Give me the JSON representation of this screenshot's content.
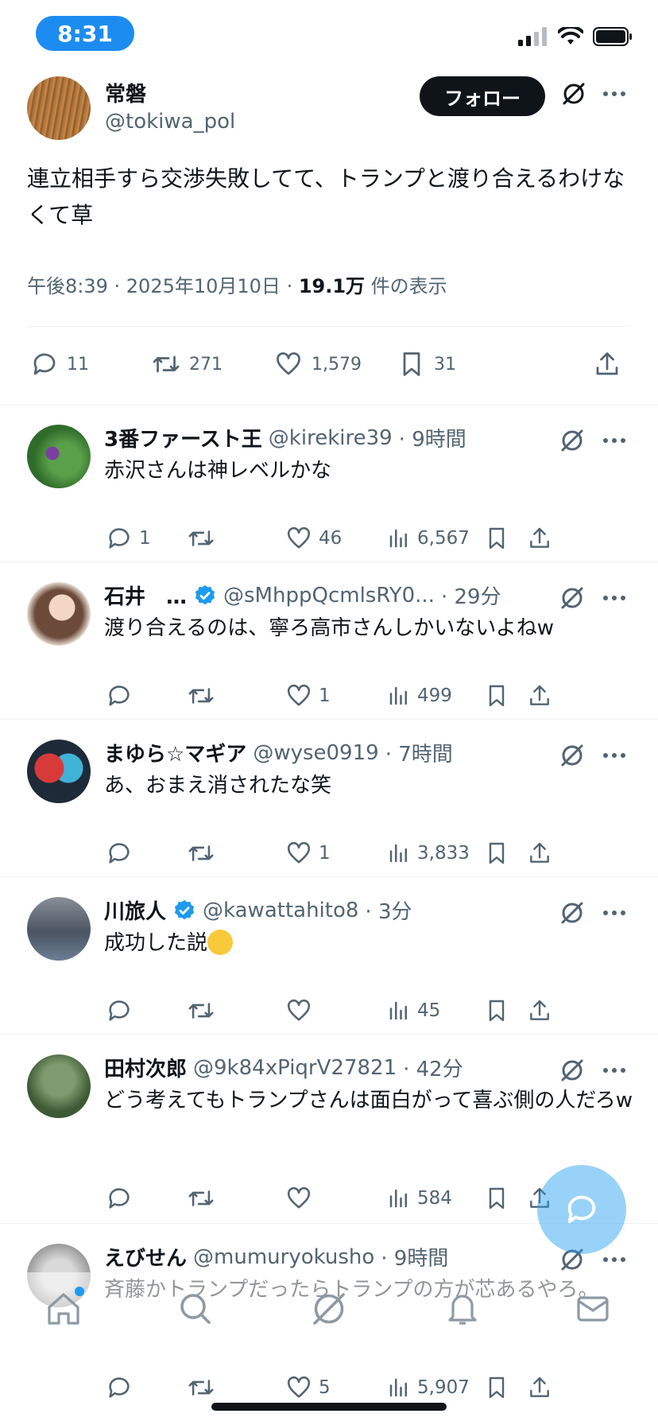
{
  "status_bar": {
    "time": "8:31"
  },
  "main_tweet": {
    "name": "常磐",
    "handle": "@tokiwa_pol",
    "follow_label": "フォロー",
    "text": "連立相手すら交渉失敗してて、トランプと渡り合えるわけなくて草",
    "meta_prefix": "午後8:39 · 2025年10月10日 · ",
    "views": "19.1万",
    "views_suffix": " 件の表示",
    "replies": "11",
    "retweets": "271",
    "likes": "1,579",
    "bookmarks": "31"
  },
  "replies": [
    {
      "name": "3番ファースト王",
      "verified": false,
      "handle": "@kirekire39",
      "time": "· 9時間",
      "text": "赤沢さんは神レベルかな",
      "replies": "1",
      "retweets": "",
      "likes": "46",
      "views": "6,567"
    },
    {
      "name": "石井　…",
      "verified": true,
      "handle": "@sMhppQcmlsRY0...",
      "time": "· 29分",
      "text": "渡り合えるのは、寧ろ高市さんしかいないよねw",
      "replies": "",
      "retweets": "",
      "likes": "1",
      "views": "499"
    },
    {
      "name": "まゆら☆マギア",
      "verified": false,
      "handle": "@wyse0919",
      "time": "· 7時間",
      "text": "あ、おまえ消されたな笑",
      "replies": "",
      "retweets": "",
      "likes": "1",
      "views": "3,833"
    },
    {
      "name": "川旅人",
      "verified": true,
      "handle": "@kawattahito8",
      "time": "· 3分",
      "text": "成功した説",
      "replies": "",
      "retweets": "",
      "likes": "",
      "views": "45"
    },
    {
      "name": "田村次郎",
      "verified": false,
      "handle": "@9k84xPiqrV27821",
      "time": "· 42分",
      "text": "どう考えてもトランプさんは面白がって喜ぶ側の人だろw",
      "replies": "",
      "retweets": "",
      "likes": "",
      "views": "584"
    },
    {
      "name": "えびせん",
      "verified": false,
      "handle": "@mumuryokusho",
      "time": "· 9時間",
      "text": "斉藤かトランプだったらトランプの方が芯あるやろ。",
      "replies": "",
      "retweets": "",
      "likes": "5",
      "views": "5,907"
    }
  ],
  "icons": {
    "reply": "reply-icon",
    "retweet": "retweet-icon",
    "like": "heart-icon",
    "views": "views-icon",
    "bookmark": "bookmark-icon",
    "share": "share-icon",
    "grok": "grok-icon",
    "more": "more-icon"
  },
  "tab_bar": [
    "home-icon",
    "search-icon",
    "grok-icon",
    "notifications-icon",
    "messages-icon"
  ],
  "colors": {
    "accent": "#1d9bf0",
    "text": "#0f1419",
    "secondary": "#536471",
    "time_pill": "#1d8cf0"
  }
}
